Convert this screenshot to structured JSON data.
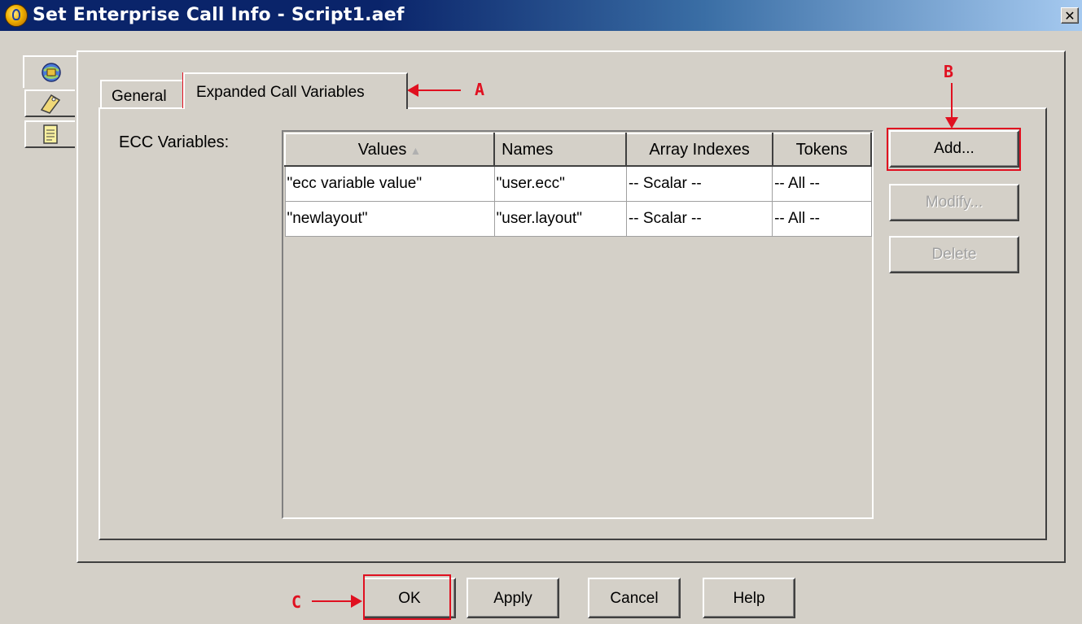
{
  "window": {
    "title": "Set Enterprise Call Info - Script1.aef",
    "close_glyph": "✕"
  },
  "side_tabs": [
    {
      "icon": "globe-phone-icon"
    },
    {
      "icon": "tag-icon"
    },
    {
      "icon": "document-icon"
    }
  ],
  "tabs": {
    "general": "General",
    "expanded": "Expanded Call Variables"
  },
  "ecc": {
    "label": "ECC Variables:",
    "columns": [
      "Values",
      "Names",
      "Array Indexes",
      "Tokens"
    ],
    "sort_indicator": "▲",
    "rows": [
      [
        "\"ecc variable value\"",
        "\"user.ecc\"",
        "-- Scalar --",
        "-- All --"
      ],
      [
        "\"newlayout\"",
        "\"user.layout\"",
        "-- Scalar --",
        "-- All --"
      ]
    ]
  },
  "side_buttons": {
    "add": "Add...",
    "modify": "Modify...",
    "delete": "Delete"
  },
  "bottom_buttons": {
    "ok": "OK",
    "apply": "Apply",
    "cancel": "Cancel",
    "help": "Help"
  },
  "annotations": {
    "a": "A",
    "b": "B",
    "c": "C",
    "color": "#e01020"
  }
}
